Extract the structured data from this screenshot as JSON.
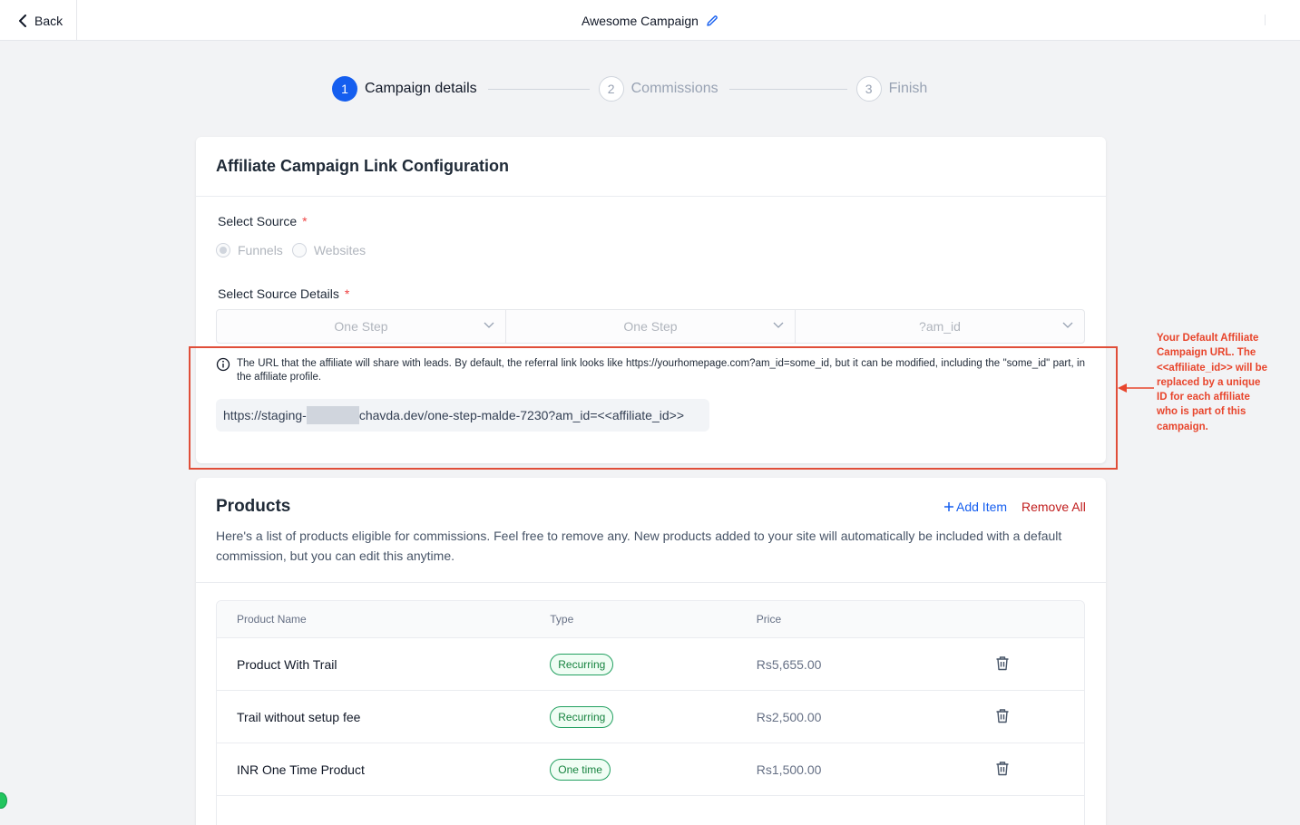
{
  "header": {
    "back_label": "Back",
    "campaign_name": "Awesome Campaign"
  },
  "stepper": {
    "steps": [
      {
        "number": "1",
        "label": "Campaign details",
        "state": "active"
      },
      {
        "number": "2",
        "label": "Commissions",
        "state": "inactive"
      },
      {
        "number": "3",
        "label": "Finish",
        "state": "inactive"
      }
    ]
  },
  "link_config": {
    "title": "Affiliate Campaign Link Configuration",
    "source_label": "Select Source",
    "required_mark": "*",
    "source_options": [
      "Funnels",
      "Websites"
    ],
    "selected_source": "Funnels",
    "source_details_label": "Select Source Details",
    "selects": [
      "One Step",
      "One Step",
      "?am_id"
    ],
    "info_text": "The URL that the affiliate will share with leads. By default, the referral link looks like https://yourhomepage.com?am_id=some_id, but it can be modified, including the \"some_id\" part, in the affiliate profile.",
    "url_prefix": "https://staging-",
    "url_suffix": "chavda.dev/one-step-malde-7230?am_id=<<affiliate_id>>"
  },
  "annotation": {
    "text": "Your Default Affiliate Campaign URL. The <<affiliate_id>> will be replaced by a unique ID for each affiliate who is part of this campaign.",
    "color": "#e8452c"
  },
  "products": {
    "title": "Products",
    "add_item_label": "Add Item",
    "remove_all_label": "Remove All",
    "description": "Here's a list of products eligible for commissions. Feel free to remove any. New products added to your site will automatically be included with a default commission, but you can edit this anytime.",
    "columns": [
      "Product Name",
      "Type",
      "Price"
    ],
    "rows": [
      {
        "name": "Product With Trail",
        "type": "Recurring",
        "price": "Rs5,655.00"
      },
      {
        "name": "Trail without setup fee",
        "type": "Recurring",
        "price": "Rs2,500.00"
      },
      {
        "name": "INR One Time Product",
        "type": "One time",
        "price": "Rs1,500.00"
      }
    ]
  },
  "colors": {
    "primary": "#155eef",
    "danger": "#c01c1c",
    "success": "#16833f"
  }
}
